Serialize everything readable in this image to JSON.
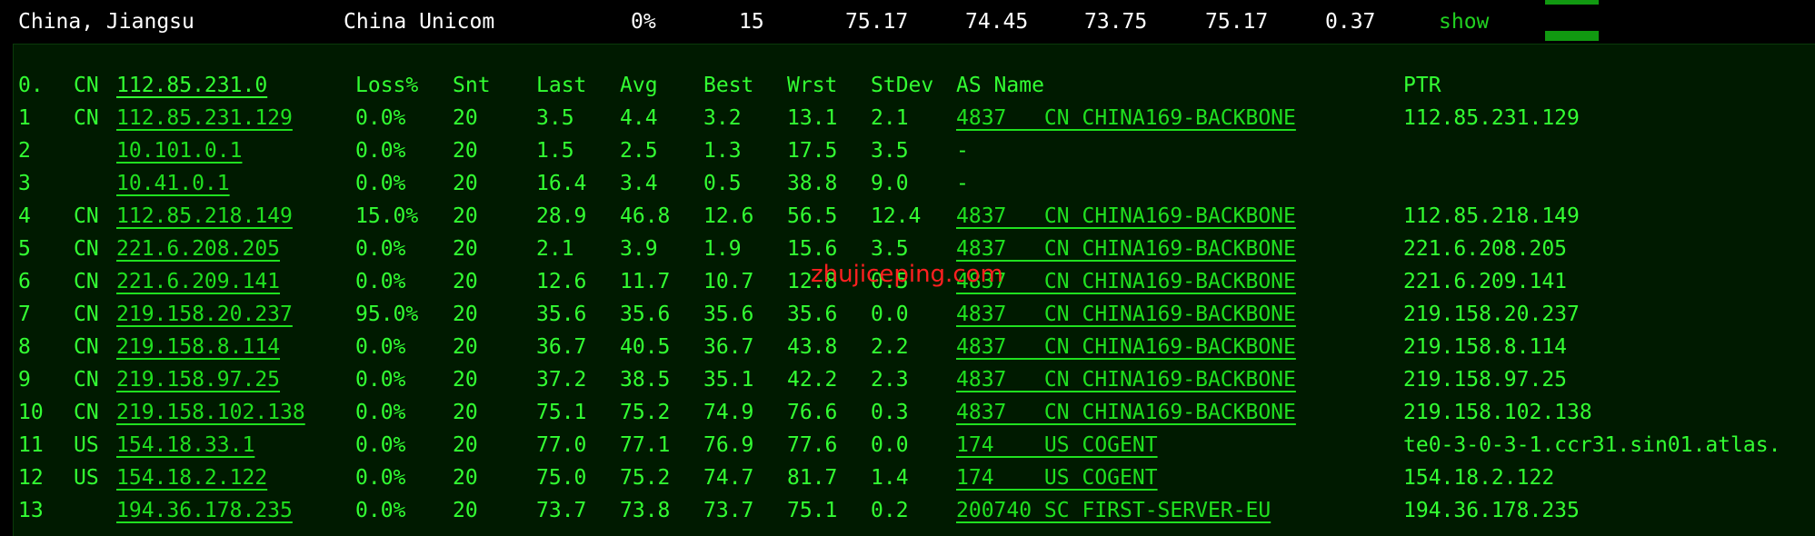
{
  "summary": {
    "location": "China, Jiangsu",
    "isp": "China Unicom",
    "loss": "0%",
    "sent": "15",
    "last": "75.17",
    "avg": "74.45",
    "best": "73.75",
    "worst": "75.17",
    "stdev": "0.37",
    "action_label": "show"
  },
  "table": {
    "headers": {
      "host": "112.85.231.0",
      "cc": "CN",
      "index": "0.",
      "loss": "Loss%",
      "snt": "Snt",
      "last": "Last",
      "avg": "Avg",
      "best": "Best",
      "wrst": "Wrst",
      "stdev": "StDev",
      "as_name": "AS Name",
      "ptr": "PTR"
    },
    "rows": [
      {
        "hop": "1",
        "cc": "CN",
        "ip": "112.85.231.129",
        "loss": "0.0%",
        "snt": "20",
        "last": "3.5",
        "avg": "4.4",
        "best": "3.2",
        "wrst": "13.1",
        "stdev": "2.1",
        "as": "4837   CN CHINA169-BACKBONE",
        "ptr": "112.85.231.129"
      },
      {
        "hop": "2",
        "cc": "",
        "ip": "10.101.0.1",
        "loss": "0.0%",
        "snt": "20",
        "last": "1.5",
        "avg": "2.5",
        "best": "1.3",
        "wrst": "17.5",
        "stdev": "3.5",
        "as": "-",
        "ptr": ""
      },
      {
        "hop": "3",
        "cc": "",
        "ip": "10.41.0.1",
        "loss": "0.0%",
        "snt": "20",
        "last": "16.4",
        "avg": "3.4",
        "best": "0.5",
        "wrst": "38.8",
        "stdev": "9.0",
        "as": "-",
        "ptr": ""
      },
      {
        "hop": "4",
        "cc": "CN",
        "ip": "112.85.218.149",
        "loss": "15.0%",
        "snt": "20",
        "last": "28.9",
        "avg": "46.8",
        "best": "12.6",
        "wrst": "56.5",
        "stdev": "12.4",
        "as": "4837   CN CHINA169-BACKBONE",
        "ptr": "112.85.218.149"
      },
      {
        "hop": "5",
        "cc": "CN",
        "ip": "221.6.208.205",
        "loss": "0.0%",
        "snt": "20",
        "last": "2.1",
        "avg": "3.9",
        "best": "1.9",
        "wrst": "15.6",
        "stdev": "3.5",
        "as": "4837   CN CHINA169-BACKBONE",
        "ptr": "221.6.208.205"
      },
      {
        "hop": "6",
        "cc": "CN",
        "ip": "221.6.209.141",
        "loss": "0.0%",
        "snt": "20",
        "last": "12.6",
        "avg": "11.7",
        "best": "10.7",
        "wrst": "12.8",
        "stdev": "0.5",
        "as": "4837   CN CHINA169-BACKBONE",
        "ptr": "221.6.209.141"
      },
      {
        "hop": "7",
        "cc": "CN",
        "ip": "219.158.20.237",
        "loss": "95.0%",
        "snt": "20",
        "last": "35.6",
        "avg": "35.6",
        "best": "35.6",
        "wrst": "35.6",
        "stdev": "0.0",
        "as": "4837   CN CHINA169-BACKBONE",
        "ptr": "219.158.20.237"
      },
      {
        "hop": "8",
        "cc": "CN",
        "ip": "219.158.8.114",
        "loss": "0.0%",
        "snt": "20",
        "last": "36.7",
        "avg": "40.5",
        "best": "36.7",
        "wrst": "43.8",
        "stdev": "2.2",
        "as": "4837   CN CHINA169-BACKBONE",
        "ptr": "219.158.8.114"
      },
      {
        "hop": "9",
        "cc": "CN",
        "ip": "219.158.97.25",
        "loss": "0.0%",
        "snt": "20",
        "last": "37.2",
        "avg": "38.5",
        "best": "35.1",
        "wrst": "42.2",
        "stdev": "2.3",
        "as": "4837   CN CHINA169-BACKBONE",
        "ptr": "219.158.97.25"
      },
      {
        "hop": "10",
        "cc": "CN",
        "ip": "219.158.102.138",
        "loss": "0.0%",
        "snt": "20",
        "last": "75.1",
        "avg": "75.2",
        "best": "74.9",
        "wrst": "76.6",
        "stdev": "0.3",
        "as": "4837   CN CHINA169-BACKBONE",
        "ptr": "219.158.102.138"
      },
      {
        "hop": "11",
        "cc": "US",
        "ip": "154.18.33.1",
        "loss": "0.0%",
        "snt": "20",
        "last": "77.0",
        "avg": "77.1",
        "best": "76.9",
        "wrst": "77.6",
        "stdev": "0.0",
        "as": "174    US COGENT",
        "ptr": "te0-3-0-3-1.ccr31.sin01.atlas."
      },
      {
        "hop": "12",
        "cc": "US",
        "ip": "154.18.2.122",
        "loss": "0.0%",
        "snt": "20",
        "last": "75.0",
        "avg": "75.2",
        "best": "74.7",
        "wrst": "81.7",
        "stdev": "1.4",
        "as": "174    US COGENT",
        "ptr": "154.18.2.122"
      },
      {
        "hop": "13",
        "cc": "",
        "ip": "194.36.178.235",
        "loss": "0.0%",
        "snt": "20",
        "last": "73.7",
        "avg": "73.8",
        "best": "73.7",
        "wrst": "75.1",
        "stdev": "0.2",
        "as": "200740 SC FIRST-SERVER-EU",
        "ptr": "194.36.178.235"
      }
    ]
  },
  "watermark": "zhujiceping.com",
  "colors": {
    "terminal_bg": "#001a00",
    "terminal_text": "#33ff33",
    "summary_text": "#ffffff",
    "accent_bar": "#119911",
    "watermark": "#ff2020"
  }
}
